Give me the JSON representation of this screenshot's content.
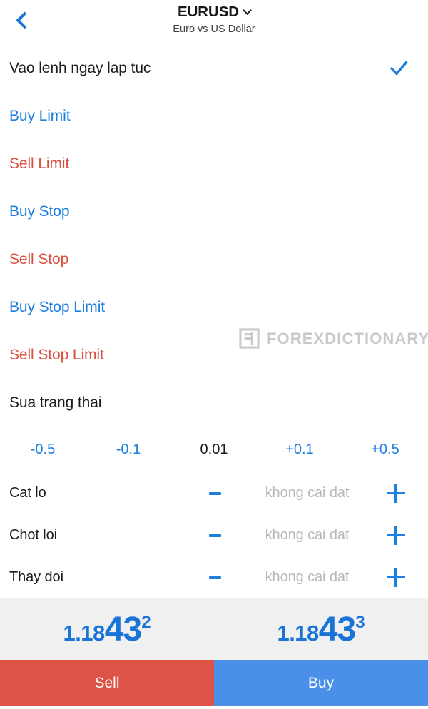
{
  "header": {
    "back_icon": "chevron-left-icon",
    "symbol": "EURUSD",
    "dropdown_icon": "chevron-down-icon",
    "subtitle": "Euro vs US Dollar"
  },
  "order_types": [
    {
      "label": "Vao lenh ngay lap tuc",
      "style": "neutral",
      "selected": true,
      "check_icon": "check-icon"
    },
    {
      "label": "Buy Limit",
      "style": "buy",
      "selected": false
    },
    {
      "label": "Sell Limit",
      "style": "sell",
      "selected": false
    },
    {
      "label": "Buy Stop",
      "style": "buy",
      "selected": false
    },
    {
      "label": "Sell Stop",
      "style": "sell",
      "selected": false
    },
    {
      "label": "Buy Stop Limit",
      "style": "buy",
      "selected": false
    },
    {
      "label": "Sell Stop Limit",
      "style": "sell",
      "selected": false
    },
    {
      "label": "Sua trang  thai",
      "style": "neutral",
      "selected": false
    }
  ],
  "volume_stepper": {
    "minus_large": "-0.5",
    "minus_small": "-0.1",
    "value": "0.01",
    "plus_small": "+0.1",
    "plus_large": "+0.5"
  },
  "params": [
    {
      "label": "Cat lo",
      "minus_icon": "minus-icon",
      "value": "khong cai dat",
      "plus_icon": "plus-icon"
    },
    {
      "label": "Chot loi",
      "minus_icon": "minus-icon",
      "value": "khong cai dat",
      "plus_icon": "plus-icon"
    },
    {
      "label": "Thay doi",
      "minus_icon": "minus-icon",
      "value": "khong cai dat",
      "plus_icon": "plus-icon"
    }
  ],
  "quote": {
    "bid": {
      "base": "1.18",
      "big": "43",
      "sup": "2"
    },
    "ask": {
      "base": "1.18",
      "big": "43",
      "sup": "3"
    }
  },
  "actions": {
    "sell_label": "Sell",
    "buy_label": "Buy"
  },
  "watermark": {
    "logo_icon": "forexdictionary-logo-icon",
    "text": "FOREXDICTIONARY"
  },
  "colors": {
    "buy_blue": "#1d7fe0",
    "sell_red": "#d9503f",
    "accent_blue": "#1a73d6",
    "sell_button": "#dd5345",
    "buy_button": "#4a90e8",
    "placeholder_gray": "#b6b8bb",
    "quote_bg": "#f0f0f0",
    "divider": "#e8e9ec"
  }
}
